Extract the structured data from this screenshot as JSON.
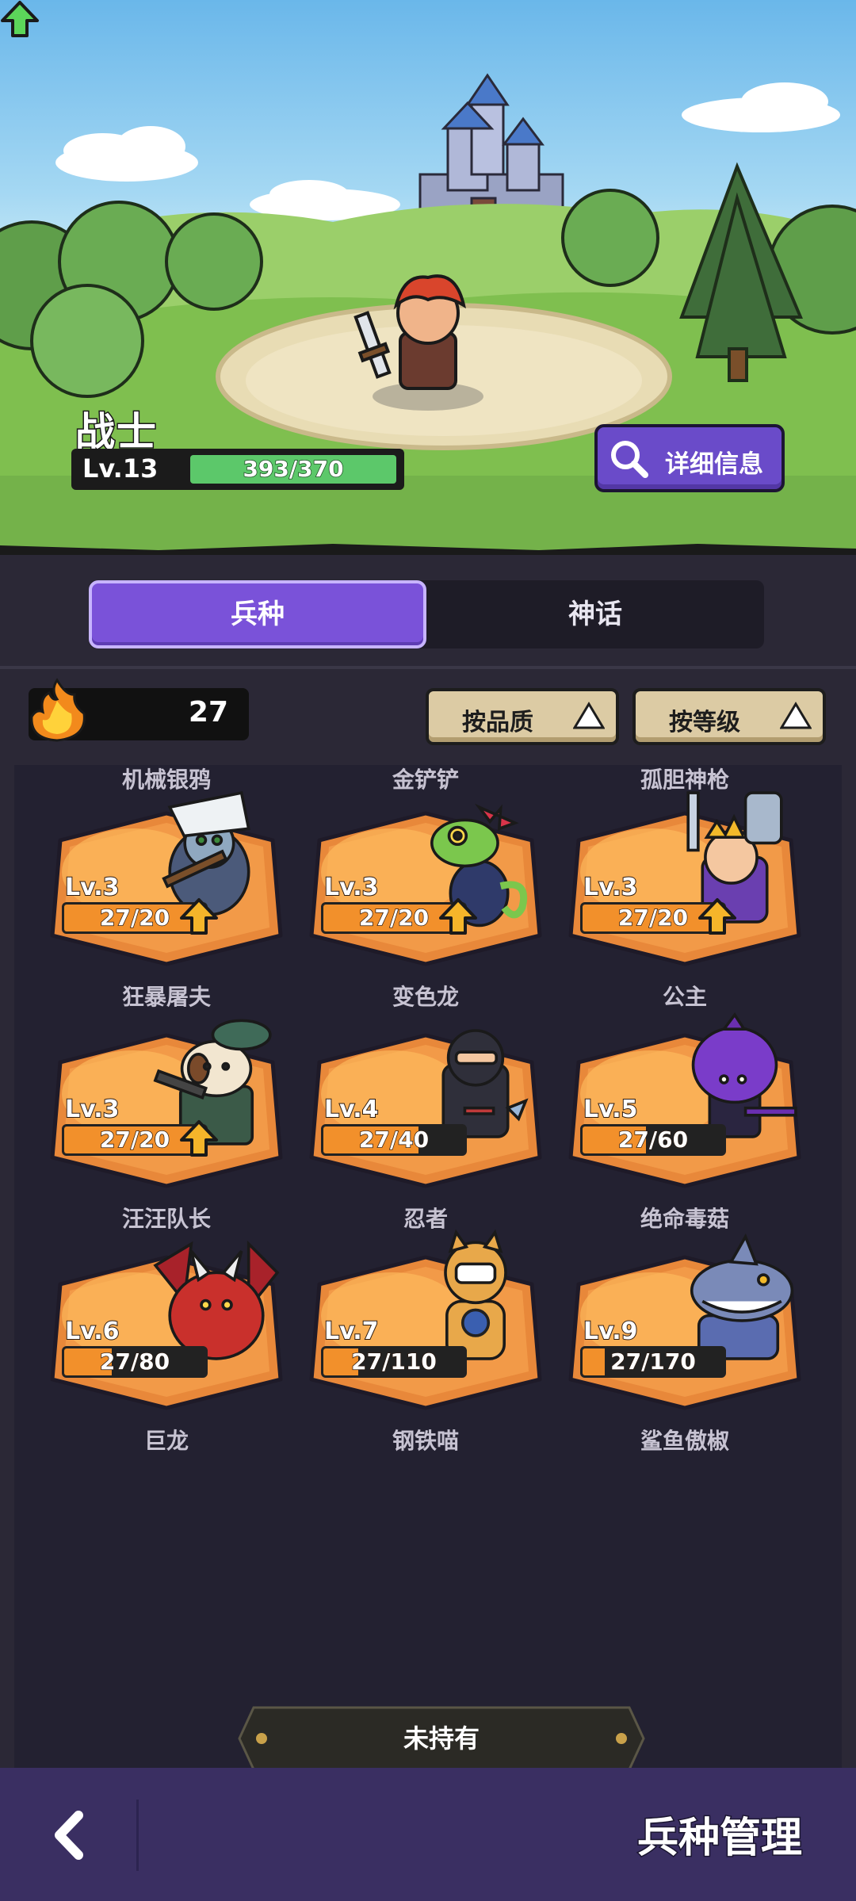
{
  "hero": {
    "name": "战士",
    "level": "Lv.13",
    "xp_text": "393/370",
    "xp_fraction": 1.0
  },
  "detail_button": {
    "label": "详细信息",
    "icon": "magnifier-icon"
  },
  "tabs": [
    {
      "label": "兵种",
      "active": true
    },
    {
      "label": "神话",
      "active": false
    }
  ],
  "resources": {
    "fire_count": "27"
  },
  "sort_buttons": [
    {
      "label": "按品质"
    },
    {
      "label": "按等级"
    }
  ],
  "top_partial_names": [
    "机械银鸦",
    "金铲铲",
    "孤胆神枪"
  ],
  "units": [
    {
      "name": "狂暴屠夫",
      "level": "Lv.3",
      "progress": "27/20",
      "fraction": 1.0,
      "upgradable": true,
      "art": "butcher"
    },
    {
      "name": "变色龙",
      "level": "Lv.3",
      "progress": "27/20",
      "fraction": 1.0,
      "upgradable": true,
      "art": "chameleon"
    },
    {
      "name": "公主",
      "level": "Lv.3",
      "progress": "27/20",
      "fraction": 1.0,
      "upgradable": true,
      "art": "princess"
    },
    {
      "name": "汪汪队长",
      "level": "Lv.3",
      "progress": "27/20",
      "fraction": 1.0,
      "upgradable": true,
      "art": "dog"
    },
    {
      "name": "忍者",
      "level": "Lv.4",
      "progress": "27/40",
      "fraction": 0.675,
      "upgradable": false,
      "art": "ninja"
    },
    {
      "name": "绝命毒菇",
      "level": "Lv.5",
      "progress": "27/60",
      "fraction": 0.45,
      "upgradable": false,
      "art": "mushroom"
    },
    {
      "name": "巨龙",
      "level": "Lv.6",
      "progress": "27/80",
      "fraction": 0.3375,
      "upgradable": false,
      "art": "dragon"
    },
    {
      "name": "钢铁喵",
      "level": "Lv.7",
      "progress": "27/110",
      "fraction": 0.245,
      "upgradable": false,
      "art": "cat"
    },
    {
      "name": "鲨鱼傲椒",
      "level": "Lv.9",
      "progress": "27/170",
      "fraction": 0.159,
      "upgradable": false,
      "art": "shark"
    }
  ],
  "unowned_label": "未持有",
  "footer": {
    "title": "兵种管理",
    "back_icon": "chevron-left-icon"
  },
  "colors": {
    "accent": "#7a52d9",
    "card": "#e8883a",
    "xp_green": "#5cc86a",
    "progress_orange": "#f2902b"
  }
}
